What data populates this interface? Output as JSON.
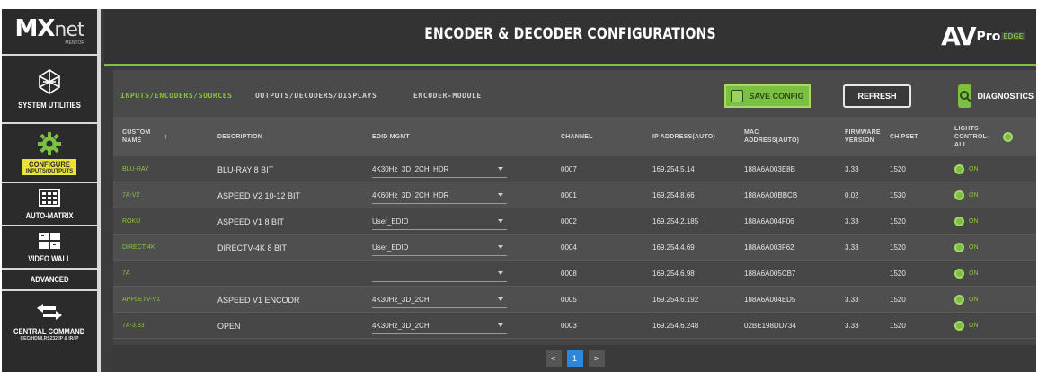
{
  "sidebar": {
    "logo_main": "MX",
    "logo_thin": "net",
    "logo_sub": "MENTOR",
    "items": [
      {
        "label": "SYSTEM UTILITIES",
        "icon": "network-globe-icon"
      },
      {
        "label": "CONFIGURE",
        "sublabel": "INPUTS/OUTPUTS",
        "icon": "gear-icon",
        "active": true
      },
      {
        "label": "AUTO-MATRIX",
        "icon": "grid-icon"
      },
      {
        "label": "VIDEO WALL",
        "icon": "video-wall-icon"
      },
      {
        "label": "ADVANCED"
      },
      {
        "label": "CENTRAL COMMAND",
        "sublabel": "CEC/HDMI,RS232/IP & IR/IP",
        "icon": "arrows-exchange-icon"
      }
    ]
  },
  "header": {
    "title": "ENCODER & DECODER CONFIGURATIONS",
    "brand_av": "AV",
    "brand_pro": "Pro",
    "brand_edge": "EDGE"
  },
  "tabs": [
    {
      "label": "INPUTS/ENCODERS/SOURCES",
      "active": true
    },
    {
      "label": "OUTPUTS/DECODERS/DISPLAYS",
      "active": false
    },
    {
      "label": "ENCODER-MODULE",
      "active": false
    }
  ],
  "toolbar": {
    "save_label": "SAVE CONFIG",
    "refresh_label": "REFRESH",
    "diagnostics_label": "DIAGNOSTICS"
  },
  "table": {
    "headers": {
      "name": "CUSTOM NAME",
      "description": "DESCRIPTION",
      "edid": "EDID MGMT",
      "channel": "CHANNEL",
      "ip": "IP ADDRESS(AUTO)",
      "mac": "MAC ADDRESS(AUTO)",
      "firmware": "FIRMWARE VERSION",
      "chipset": "CHIPSET",
      "lights": "LIGHTS CONTROL- ALL"
    },
    "rows": [
      {
        "name": "BLU-RAY",
        "description": "BLU-RAY 8 BIT",
        "edid": "4K30Hz_3D_2CH_HDR",
        "channel": "0007",
        "ip": "169.254.5.14",
        "mac": "188A6A003E8B",
        "firmware": "3.33",
        "chipset": "1520",
        "light": "ON"
      },
      {
        "name": "7A-V2",
        "description": "ASPEED V2 10-12 BIT",
        "edid": "4K60Hz_3D_2CH_HDR",
        "channel": "0001",
        "ip": "169.254.8.66",
        "mac": "188A6A00BBCB",
        "firmware": "0.02",
        "chipset": "1530",
        "light": "ON"
      },
      {
        "name": "ROKU",
        "description": "ASPEED V1 8 BIT",
        "edid": "User_EDID",
        "channel": "0002",
        "ip": "169.254.2.185",
        "mac": "188A6A004F06",
        "firmware": "3.33",
        "chipset": "1520",
        "light": "ON"
      },
      {
        "name": "DIRECT-4K",
        "description": "DIRECTV-4K 8 BIT",
        "edid": "User_EDID",
        "channel": "0004",
        "ip": "169.254.4.69",
        "mac": "188A6A003F62",
        "firmware": "3.33",
        "chipset": "1520",
        "light": "ON"
      },
      {
        "name": "7A",
        "description": "",
        "edid": "",
        "channel": "0008",
        "ip": "169.254.6.98",
        "mac": "188A6A005CB7",
        "firmware": "",
        "chipset": "1520",
        "light": "ON"
      },
      {
        "name": "APPLETV-V1",
        "description": "ASPEED V1 ENCODR",
        "edid": "4K30Hz_3D_2CH",
        "channel": "0005",
        "ip": "169.254.6.192",
        "mac": "188A6A004ED5",
        "firmware": "3.33",
        "chipset": "1520",
        "light": "ON"
      },
      {
        "name": "7A-3.33",
        "description": "OPEN",
        "edid": "4K30Hz_3D_2CH",
        "channel": "0003",
        "ip": "169.254.6.248",
        "mac": "02BE198DD734",
        "firmware": "3.33",
        "chipset": "1520",
        "light": "ON"
      }
    ]
  },
  "pagination": {
    "prev": "<",
    "current": "1",
    "next": ">"
  },
  "colors": {
    "accent_green": "#7cc043",
    "page_current": "#2d86d9",
    "header_bg": "#333333"
  }
}
